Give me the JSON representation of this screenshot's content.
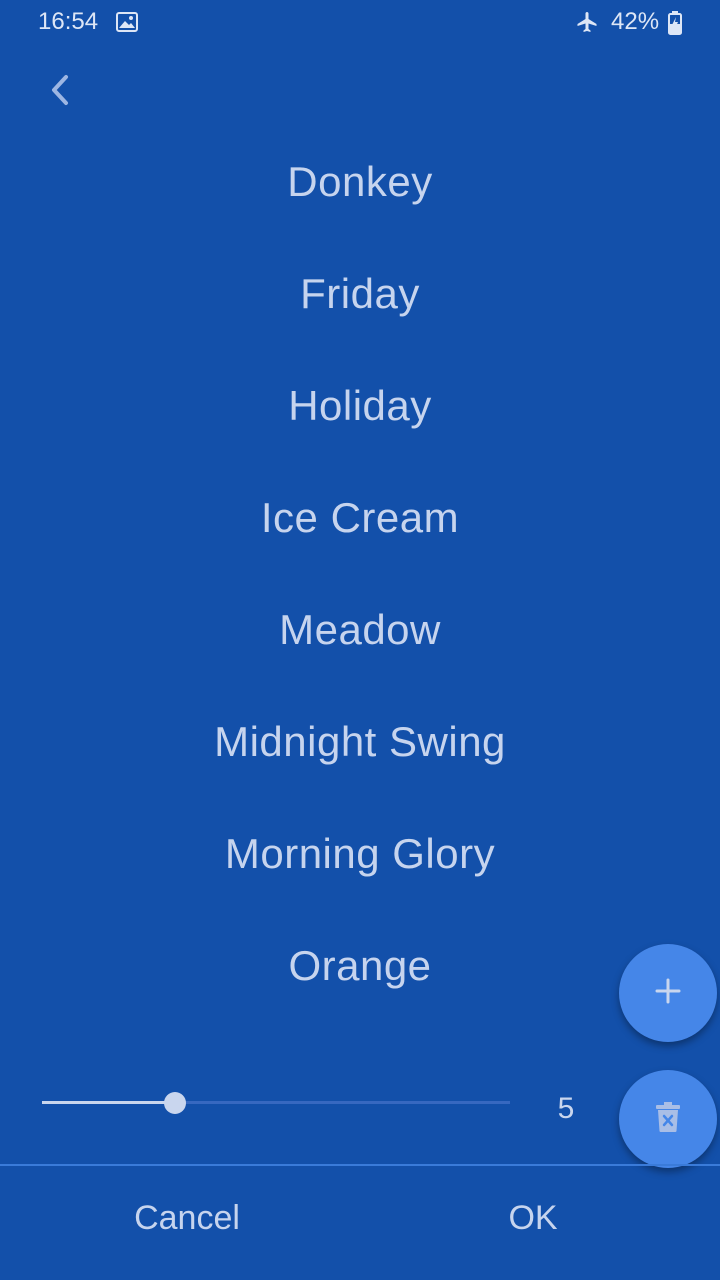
{
  "status_bar": {
    "time": "16:54",
    "battery": "42%",
    "icons": [
      "gallery-icon",
      "airplane-mode-icon",
      "battery-charging-icon"
    ]
  },
  "header": {
    "back_icon": "chevron-left-icon"
  },
  "list": {
    "items": [
      "Donkey",
      "Friday",
      "Holiday",
      "Ice Cream",
      "Meadow",
      "Midnight Swing",
      "Morning Glory",
      "Orange"
    ]
  },
  "slider": {
    "value": "5",
    "fill_fraction": 0.285
  },
  "fabs": {
    "add_icon": "plus-icon",
    "delete_icon": "trash-icon"
  },
  "dialog": {
    "cancel_label": "Cancel",
    "ok_label": "OK"
  },
  "colors": {
    "background": "#1350AA",
    "fab": "#4586E8",
    "text": "#C6D4EE",
    "divider": "#3A7BD9"
  }
}
